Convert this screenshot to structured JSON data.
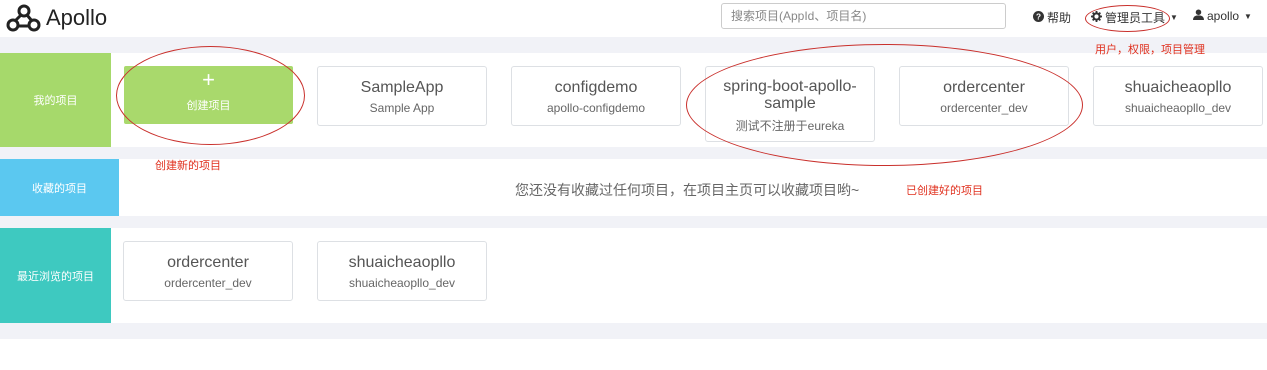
{
  "app": {
    "name": "Apollo"
  },
  "header": {
    "search_placeholder": "搜索项目(AppId、项目名)",
    "help_label": "帮助",
    "admin_label": "管理员工具",
    "user_label": "apollo"
  },
  "sections": {
    "my_projects": "我的项目",
    "favorites": "收藏的项目",
    "recent": "最近浏览的项目"
  },
  "create_project": {
    "label": "创建项目",
    "plus": "+"
  },
  "my_projects": [
    {
      "name": "SampleApp",
      "sub": "Sample App"
    },
    {
      "name": "configdemo",
      "sub": "apollo-configdemo"
    },
    {
      "name": "spring-boot-apollo-sample",
      "sub": "测试不注册于eureka"
    },
    {
      "name": "ordercenter",
      "sub": "ordercenter_dev"
    },
    {
      "name": "shuaicheaopllo",
      "sub": "shuaicheaopllo_dev"
    }
  ],
  "favorites_empty": "您还没有收藏过任何项目，在项目主页可以收藏项目哟~",
  "recent_projects": [
    {
      "name": "ordercenter",
      "sub": "ordercenter_dev"
    },
    {
      "name": "shuaicheaopllo",
      "sub": "shuaicheaopllo_dev"
    }
  ],
  "annotations": {
    "create_new": "创建新的项目",
    "created": "已创建好的项目",
    "admin_note": "用户，权限，项目管理"
  },
  "colors": {
    "my_projects": "#a6d96b",
    "favorites": "#5bc8f0",
    "recent": "#3ec9c0",
    "annotation": "#e0301e"
  }
}
